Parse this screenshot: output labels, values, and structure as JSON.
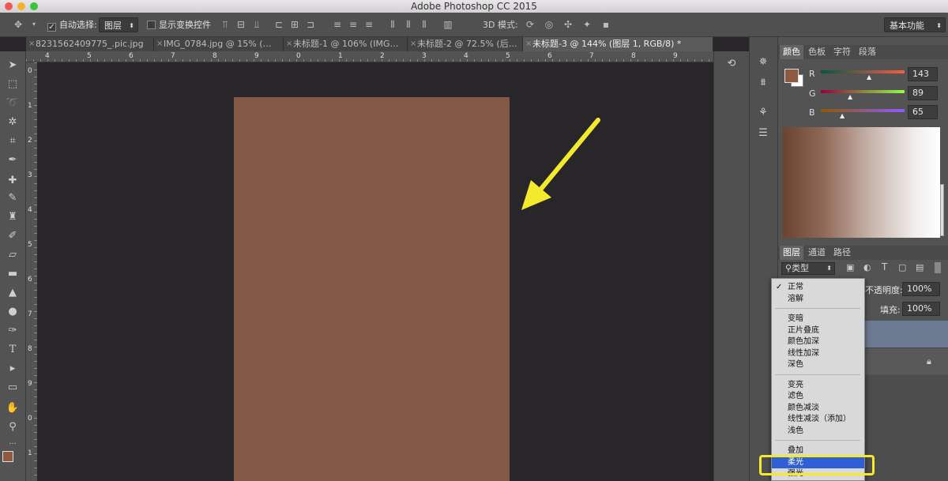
{
  "window": {
    "title": "Adobe Photoshop CC 2015"
  },
  "options_bar": {
    "auto_select_label": "自动选择:",
    "auto_select_value": "图层",
    "show_transform_label": "显示变换控件",
    "mode_3d_label": "3D 模式:",
    "workspace": "基本功能"
  },
  "tabs": [
    {
      "label": "8231562409775_.pic.jpg",
      "active": false
    },
    {
      "label": "IMG_0784.jpg @ 15% (…",
      "active": false
    },
    {
      "label": "未标题-1 @ 106% (IMG…",
      "active": false
    },
    {
      "label": "未标题-2 @ 72.5% (后…",
      "active": false
    },
    {
      "label": "未标题-3 @ 144% (图层 1, RGB/8) *",
      "active": true
    }
  ],
  "rulers": {
    "h": [
      "4",
      "5",
      "6",
      "7",
      "8",
      "9",
      "0",
      "1",
      "2",
      "3",
      "4",
      "5",
      "6",
      "7",
      "8",
      "9"
    ],
    "v": [
      "0",
      "1",
      "2",
      "3",
      "4",
      "5",
      "6",
      "7",
      "8",
      "9",
      "0",
      "1",
      "2"
    ]
  },
  "color_panel": {
    "tabs": [
      "颜色",
      "色板",
      "字符",
      "段落"
    ],
    "r_label": "R",
    "g_label": "G",
    "b_label": "B",
    "r": "143",
    "g": "89",
    "b": "65",
    "foreground": "#8f5941"
  },
  "layers_panel": {
    "tabs": [
      "图层",
      "通道",
      "路径"
    ],
    "filter": "类型",
    "opacity_label": "不透明度:",
    "opacity": "100%",
    "fill_label": "填充:",
    "fill": "100%"
  },
  "blend_menu": {
    "groups": [
      [
        "正常",
        "溶解"
      ],
      [
        "变暗",
        "正片叠底",
        "颜色加深",
        "线性加深",
        "深色"
      ],
      [
        "变亮",
        "滤色",
        "颜色减淡",
        "线性减淡（添加）",
        "浅色"
      ],
      [
        "叠加",
        "柔光",
        "强光"
      ]
    ],
    "checked": "正常",
    "highlighted": "柔光"
  },
  "colors": {
    "canvas_fill": "#845847",
    "annotation": "#f3ea2c",
    "menu_highlight": "#2e5fd6"
  }
}
